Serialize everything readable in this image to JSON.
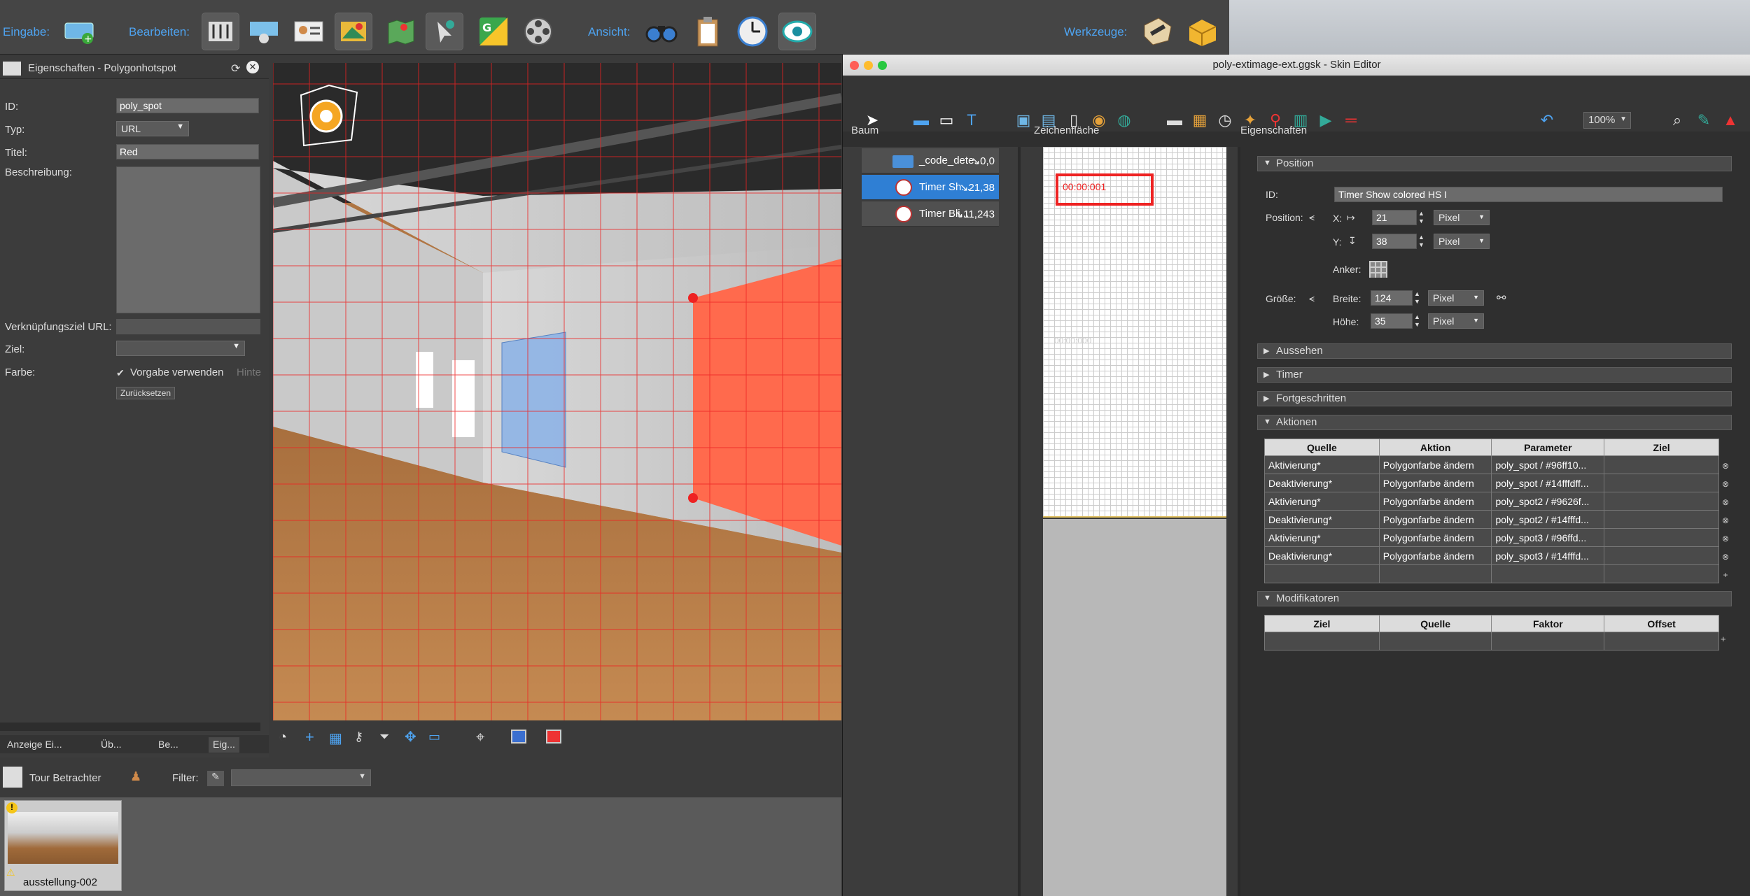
{
  "toolbar": {
    "eingabe_label": "Eingabe:",
    "bearbeiten_label": "Bearbeiten:",
    "ansicht_label": "Ansicht:",
    "werkzeuge_label": "Werkzeuge:"
  },
  "props": {
    "title": "Eigenschaften - Polygonhotspot",
    "id_label": "ID:",
    "id_value": "poly_spot",
    "typ_label": "Typ:",
    "typ_value": "URL",
    "titel_label": "Titel:",
    "titel_value": "Red",
    "beschreibung_label": "Beschreibung:",
    "url_label": "Verknüpfungsziel URL:",
    "ziel_label": "Ziel:",
    "farbe_label": "Farbe:",
    "vorgabe_label": "Vorgabe verwenden",
    "hint_label": "Hinte",
    "reset_label": "Zurücksetzen"
  },
  "tabs": [
    "Anzeige Ei...",
    "Üb...",
    "Be...",
    "Eig..."
  ],
  "tour": {
    "title": "Tour Betrachter",
    "filter_label": "Filter:",
    "thumb_label": "ausstellung-002"
  },
  "skin": {
    "window_title": "poly-extimage-ext.ggsk - Skin Editor",
    "zoom": "100%",
    "baum_label": "Baum",
    "zeichen_label": "Zeichenfläche",
    "eigen_label": "Eigenschaften",
    "tree": [
      {
        "name": "_code_dete...",
        "coord": "↘0,0"
      },
      {
        "name": "Timer Sh...",
        "coord": "↘21,38"
      },
      {
        "name": "Timer Bli...",
        "coord": "↘11,243"
      }
    ],
    "canvas_timer": "00:00:001",
    "canvas_timer2": "00:00:000",
    "position_label": "Position",
    "id_label": "ID:",
    "id_value": "Timer Show colored HS I",
    "pos_label": "Position:",
    "x_label": "X:",
    "x_value": "21",
    "y_label": "Y:",
    "y_value": "38",
    "unit": "Pixel",
    "anker_label": "Anker:",
    "groesse_label": "Größe:",
    "breite_label": "Breite:",
    "breite_value": "124",
    "hoehe_label": "Höhe:",
    "hoehe_value": "35",
    "sections": [
      "Aussehen",
      "Timer",
      "Fortgeschritten"
    ],
    "aktionen_label": "Aktionen",
    "actions_headers": [
      "Quelle",
      "Aktion",
      "Parameter",
      "Ziel"
    ],
    "actions": [
      [
        "Aktivierung*",
        "Polygonfarbe ändern",
        "poly_spot / #96ff10...",
        ""
      ],
      [
        "Deaktivierung*",
        "Polygonfarbe ändern",
        "poly_spot / #14fffdff...",
        ""
      ],
      [
        "Aktivierung*",
        "Polygonfarbe ändern",
        "poly_spot2 / #9626f...",
        ""
      ],
      [
        "Deaktivierung*",
        "Polygonfarbe ändern",
        "poly_spot2 / #14fffd...",
        ""
      ],
      [
        "Aktivierung*",
        "Polygonfarbe ändern",
        "poly_spot3 / #96ffd...",
        ""
      ],
      [
        "Deaktivierung*",
        "Polygonfarbe ändern",
        "poly_spot3 / #14fffd...",
        ""
      ]
    ],
    "modifikatoren_label": "Modifikatoren",
    "mod_headers": [
      "Ziel",
      "Quelle",
      "Faktor",
      "Offset"
    ]
  }
}
